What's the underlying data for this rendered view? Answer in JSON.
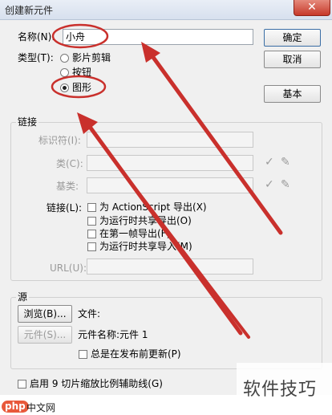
{
  "window": {
    "title": "创建新元件",
    "close_glyph": "✕"
  },
  "name_row": {
    "label": "名称(N):",
    "value": "小舟"
  },
  "type_row": {
    "label": "类型(T):",
    "options": [
      {
        "label": "影片剪辑",
        "selected": false
      },
      {
        "label": "按钮",
        "selected": false
      },
      {
        "label": "图形",
        "selected": true
      }
    ]
  },
  "buttons": {
    "ok": "确定",
    "cancel": "取消",
    "basic": "基本"
  },
  "linkage": {
    "section_title": "链接",
    "identifier_label": "标识符(I):",
    "class_label": "类(C):",
    "base_class_label": "基类:",
    "linkage_label": "链接(L):",
    "checkboxes": [
      "为 ActionScript 导出(X)",
      "为运行时共享导出(O)",
      "在第一帧导出(F)",
      "为运行时共享导入(M)"
    ],
    "url_label": "URL(U):",
    "check_glyph": "✓",
    "pencil_glyph": "✎"
  },
  "source": {
    "section_title": "源",
    "browse_button": "浏览(B)...",
    "file_label": "文件:",
    "symbol_button": "元件(S)...",
    "symbol_name": "元件名称:元件 1",
    "always_update": "总是在发布前更新(P)"
  },
  "scale9": {
    "label": "启用 9 切片缩放比例辅助线(G)"
  },
  "watermark": {
    "text": "软件技巧"
  },
  "logo": {
    "php": "php",
    "cn": "中文网"
  },
  "colors": {
    "annotation_red": "#c9302c",
    "dialog_bg": "#f0f0f0"
  }
}
